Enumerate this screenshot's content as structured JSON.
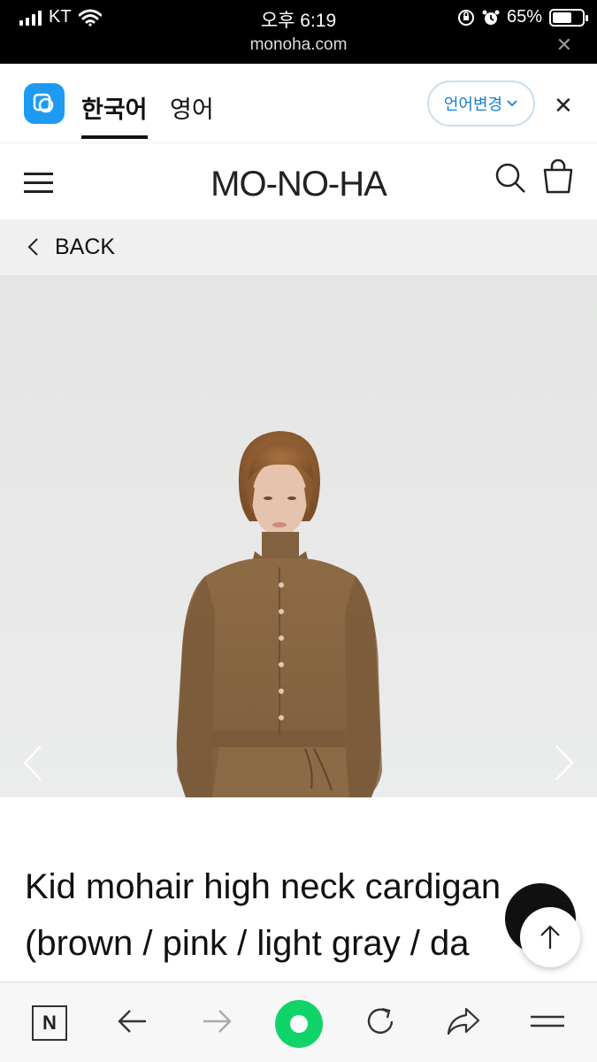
{
  "status_bar": {
    "carrier": "KT",
    "time": "오후 6:19",
    "battery": "65%",
    "battery_level": 0.65,
    "url": "monoha.com"
  },
  "translate_bar": {
    "lang_active": "한국어",
    "lang_second": "영어",
    "change_button": "언어변경"
  },
  "header": {
    "logo": "MO-NO-HA"
  },
  "back": {
    "label": "BACK"
  },
  "product": {
    "title_line1": "Kid mohair high neck cardigan",
    "title_line2": "(brown / pink / light gray / da"
  },
  "icons": {
    "menu": "hamburger-icon",
    "search": "search-icon",
    "bag": "shopping-bag-icon",
    "back": "chevron-left-icon",
    "prev": "chevron-left-icon",
    "next": "chevron-right-icon",
    "scroll_top": "arrow-up-icon",
    "toolbar": [
      "naver-n-icon",
      "back-arrow-icon",
      "forward-arrow-icon",
      "green-circle-icon",
      "reload-icon",
      "share-icon",
      "menu-icon"
    ]
  },
  "colors": {
    "accent_blue": "#1a7fd1",
    "papago_blue": "#1e9bf0",
    "green": "#10d46a",
    "cardigan_brown": "#8a6a45"
  }
}
